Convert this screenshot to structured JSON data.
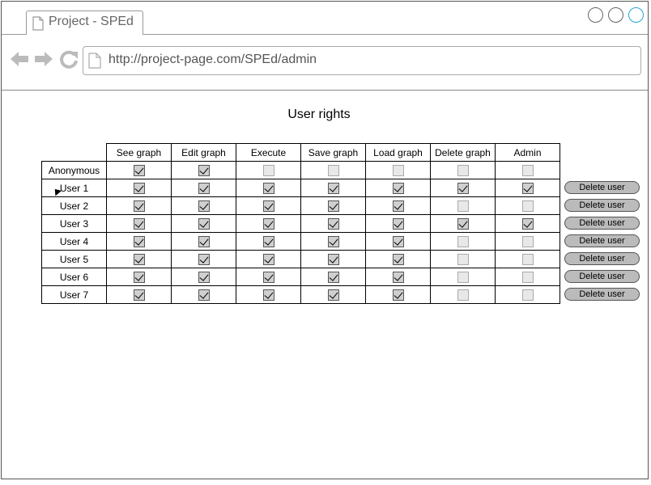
{
  "browser": {
    "tab_title": "Project - SPEd",
    "url": "http://project-page.com/SPEd/admin"
  },
  "page": {
    "title": "User rights"
  },
  "table": {
    "columns": [
      "See graph",
      "Edit graph",
      "Execute",
      "Save graph",
      "Load graph",
      "Delete graph",
      "Admin"
    ],
    "rows": [
      {
        "user": "Anonymous",
        "rights": [
          true,
          true,
          false,
          false,
          false,
          false,
          false
        ],
        "delete_label": ""
      },
      {
        "user": "User 1",
        "rights": [
          true,
          true,
          true,
          true,
          true,
          true,
          true
        ],
        "delete_label": "Delete user"
      },
      {
        "user": "User 2",
        "rights": [
          true,
          true,
          true,
          true,
          true,
          false,
          false
        ],
        "delete_label": "Delete user"
      },
      {
        "user": "User 3",
        "rights": [
          true,
          true,
          true,
          true,
          true,
          true,
          true
        ],
        "delete_label": "Delete user"
      },
      {
        "user": "User 4",
        "rights": [
          true,
          true,
          true,
          true,
          true,
          false,
          false
        ],
        "delete_label": "Delete user"
      },
      {
        "user": "User 5",
        "rights": [
          true,
          true,
          true,
          true,
          true,
          false,
          false
        ],
        "delete_label": "Delete user"
      },
      {
        "user": "User 6",
        "rights": [
          true,
          true,
          true,
          true,
          true,
          false,
          false
        ],
        "delete_label": "Delete user"
      },
      {
        "user": "User 7",
        "rights": [
          true,
          true,
          true,
          true,
          true,
          false,
          false
        ],
        "delete_label": "Delete user"
      }
    ]
  },
  "icons": [
    "document-icon",
    "back-arrow-icon",
    "forward-arrow-icon",
    "reload-icon",
    "window-button-icon"
  ]
}
